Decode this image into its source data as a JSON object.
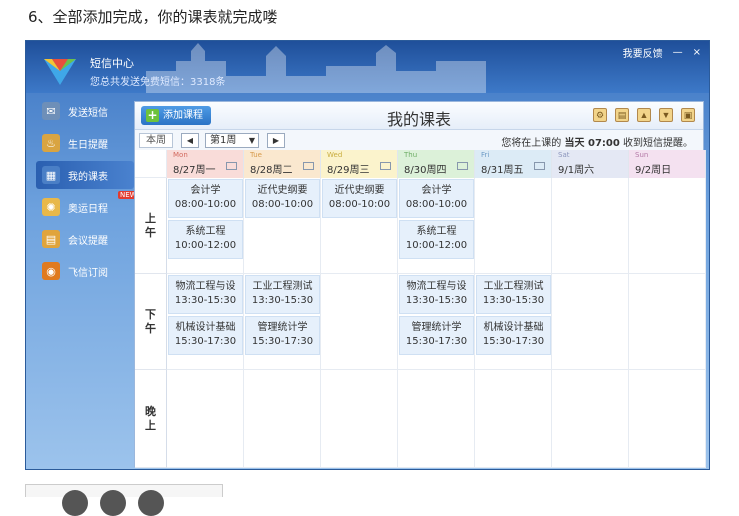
{
  "caption": "6、全部添加完成，你的课表就完成喽",
  "window": {
    "title": "短信中心",
    "subtitle": "您总共发送免费短信：3318条",
    "feedback": "我要反馈",
    "minimize": "—",
    "close": "×"
  },
  "sidebar": {
    "items": [
      {
        "label": "发送短信",
        "icon": "sms-icon",
        "color": "#6e8fb8"
      },
      {
        "label": "生日提醒",
        "icon": "cake-icon",
        "color": "#d9a441"
      },
      {
        "label": "我的课表",
        "icon": "calendar-icon",
        "color": "#4a7fc6",
        "active": true
      },
      {
        "label": "奥运日程",
        "icon": "olympic-icon",
        "color": "#e8b84a",
        "badge": "NEW"
      },
      {
        "label": "会议提醒",
        "icon": "clipboard-icon",
        "color": "#e0a43c"
      },
      {
        "label": "飞信订阅",
        "icon": "rss-icon",
        "color": "#e07a1f"
      }
    ]
  },
  "panel": {
    "add_button": "添加课程",
    "title": "我的课表",
    "tools": [
      "settings-icon",
      "print-icon",
      "upload-icon",
      "download-icon",
      "export-icon"
    ]
  },
  "nav": {
    "this_week": "本周",
    "prev": "◀",
    "week": "第1周",
    "next": "▶",
    "remind_prefix": "您将在上课的",
    "remind_bold": "当天 07:00",
    "remind_suffix": "收到短信提醒。"
  },
  "days": [
    {
      "en": "Mon",
      "label": "8/27周一",
      "bg": "#f9dcd9",
      "en_color": "#d26a5f",
      "mail": true
    },
    {
      "en": "Tue",
      "label": "8/28周二",
      "bg": "#fae8cf",
      "en_color": "#d69a4a",
      "mail": true
    },
    {
      "en": "Wed",
      "label": "8/29周三",
      "bg": "#fbf3cc",
      "en_color": "#c9ad3f",
      "mail": true
    },
    {
      "en": "Thu",
      "label": "8/30周四",
      "bg": "#dcf1d9",
      "en_color": "#6fae67",
      "mail": true
    },
    {
      "en": "Fri",
      "label": "8/31周五",
      "bg": "#dcebf6",
      "en_color": "#6e9cc6",
      "mail": true
    },
    {
      "en": "Sat",
      "label": "9/1周六",
      "bg": "#e4e8f4",
      "en_color": "#8d96bd",
      "mail": false
    },
    {
      "en": "Sun",
      "label": "9/2周日",
      "bg": "#f4e1f0",
      "en_color": "#b57aa8",
      "mail": false
    }
  ],
  "periods": [
    "上午",
    "下午",
    "晚上"
  ],
  "courses": {
    "am1": [
      {
        "day": 0,
        "name": "会计学",
        "time": "08:00-10:00"
      },
      {
        "day": 1,
        "name": "近代史纲要",
        "time": "08:00-10:00"
      },
      {
        "day": 2,
        "name": "近代史纲要",
        "time": "08:00-10:00"
      },
      {
        "day": 3,
        "name": "会计学",
        "time": "08:00-10:00"
      }
    ],
    "am2": [
      {
        "day": 0,
        "name": "系统工程",
        "time": "10:00-12:00"
      },
      {
        "day": 3,
        "name": "系统工程",
        "time": "10:00-12:00"
      }
    ],
    "pm1": [
      {
        "day": 0,
        "name": "物流工程与设",
        "time": "13:30-15:30"
      },
      {
        "day": 1,
        "name": "工业工程测试",
        "time": "13:30-15:30"
      },
      {
        "day": 3,
        "name": "物流工程与设",
        "time": "13:30-15:30"
      },
      {
        "day": 4,
        "name": "工业工程测试",
        "time": "13:30-15:30"
      }
    ],
    "pm2": [
      {
        "day": 0,
        "name": "机械设计基础",
        "time": "15:30-17:30"
      },
      {
        "day": 1,
        "name": "管理统计学",
        "time": "15:30-17:30"
      },
      {
        "day": 3,
        "name": "管理统计学",
        "time": "15:30-17:30"
      },
      {
        "day": 4,
        "name": "机械设计基础",
        "time": "15:30-17:30"
      }
    ]
  }
}
